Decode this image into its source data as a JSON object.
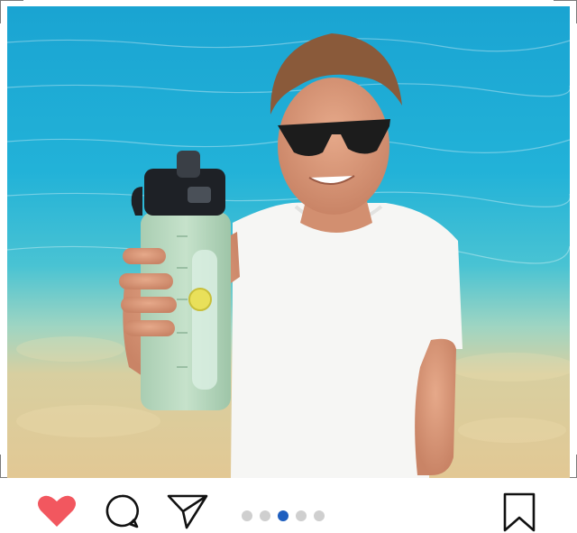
{
  "post": {
    "image": {
      "subject": "man-holding-water-bottle-on-beach"
    },
    "actions": {
      "like": {
        "icon": "heart-icon",
        "liked": true,
        "color": "#f2575f"
      },
      "comment": {
        "icon": "comment-bubble-icon"
      },
      "share": {
        "icon": "paper-plane-icon"
      },
      "save": {
        "icon": "bookmark-icon"
      }
    },
    "carousel": {
      "total": 5,
      "active_index": 2,
      "active_color": "#1f5fbf",
      "inactive_color": "#cfcfcf"
    }
  }
}
